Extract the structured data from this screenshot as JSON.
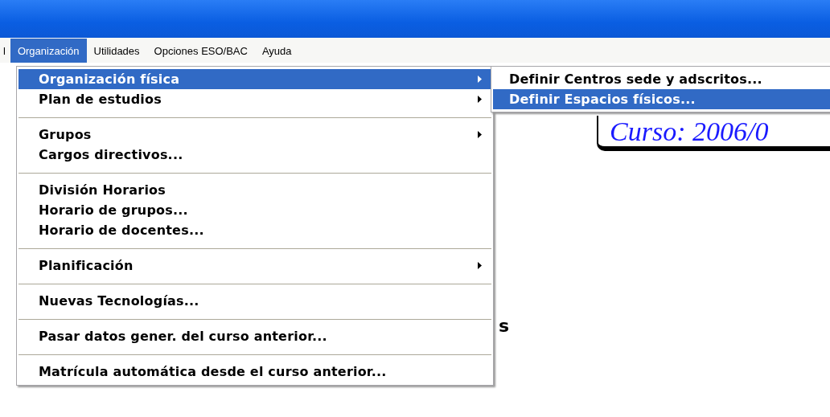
{
  "menubar": [
    {
      "label": "l",
      "selected": false
    },
    {
      "label": "Organización",
      "selected": true
    },
    {
      "label": "Utilidades",
      "selected": false
    },
    {
      "label": "Opciones ESO/BAC",
      "selected": false
    },
    {
      "label": "Ayuda",
      "selected": false
    }
  ],
  "background": {
    "course_title": "Curso: 2006/0",
    "fragment": "s"
  },
  "menu": {
    "items": [
      {
        "kind": "item",
        "label": "Organización física",
        "submenu": true,
        "selected": true
      },
      {
        "kind": "item",
        "label": "Plan de estudios",
        "submenu": true,
        "selected": false
      },
      {
        "kind": "separator"
      },
      {
        "kind": "item",
        "label": "Grupos",
        "submenu": true,
        "selected": false
      },
      {
        "kind": "item",
        "label": "Cargos directivos...",
        "submenu": false,
        "selected": false
      },
      {
        "kind": "separator"
      },
      {
        "kind": "item",
        "label": "División Horarios",
        "submenu": false,
        "selected": false
      },
      {
        "kind": "item",
        "label": "Horario de grupos...",
        "submenu": false,
        "selected": false
      },
      {
        "kind": "item",
        "label": "Horario de docentes...",
        "submenu": false,
        "selected": false
      },
      {
        "kind": "separator"
      },
      {
        "kind": "item",
        "label": "Planificación",
        "submenu": true,
        "selected": false
      },
      {
        "kind": "separator"
      },
      {
        "kind": "item",
        "label": "Nuevas Tecnologías...",
        "submenu": false,
        "selected": false
      },
      {
        "kind": "separator"
      },
      {
        "kind": "item",
        "label": "Pasar datos gener. del curso anterior...",
        "submenu": false,
        "selected": false
      },
      {
        "kind": "separator"
      },
      {
        "kind": "item",
        "label": "Matrícula automática desde el curso anterior...",
        "submenu": false,
        "selected": false
      }
    ]
  },
  "submenu": {
    "items": [
      {
        "label": "Definir Centros sede y adscritos...",
        "selected": false
      },
      {
        "label": "Definir Espacios físicos...",
        "selected": true
      }
    ]
  }
}
